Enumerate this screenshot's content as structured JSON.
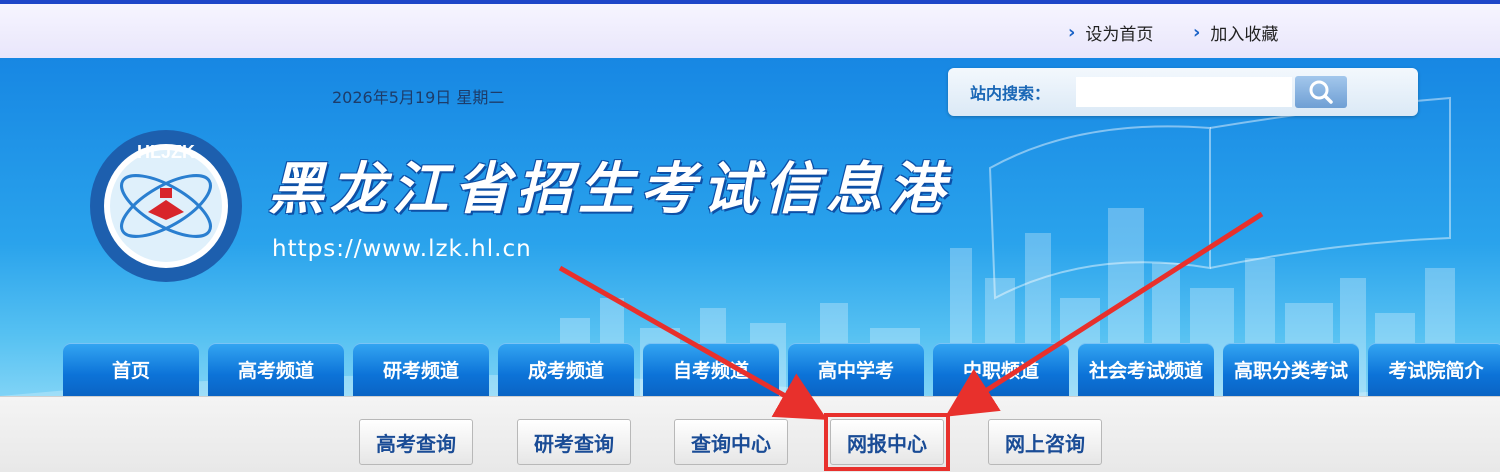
{
  "top_links": [
    {
      "label": "设为首页"
    },
    {
      "label": "加入收藏"
    }
  ],
  "header": {
    "date": "2026年5月19日 星期二",
    "site_title": "黑龙江省招生考试信息港",
    "site_url": "https://www.lzk.hl.cn",
    "logo_text": "HLJZK",
    "logo_ring_text": "黑龙江招生考试信息港"
  },
  "search": {
    "label": "站内搜索：",
    "placeholder": "",
    "value": ""
  },
  "nav": [
    {
      "label": "首页"
    },
    {
      "label": "高考频道"
    },
    {
      "label": "研考频道"
    },
    {
      "label": "成考频道"
    },
    {
      "label": "自考频道"
    },
    {
      "label": "高中学考"
    },
    {
      "label": "中职频道"
    },
    {
      "label": "社会考试频道"
    },
    {
      "label": "高职分类考试"
    },
    {
      "label": "考试院简介"
    }
  ],
  "sub_buttons": [
    {
      "label": "高考查询"
    },
    {
      "label": "研考查询"
    },
    {
      "label": "查询中心"
    },
    {
      "label": "网报中心"
    },
    {
      "label": "网上咨询"
    }
  ],
  "annotation": {
    "highlighted_button": "网报中心",
    "color": "#e8302c"
  },
  "colors": {
    "nav_blue": "#0c73d8",
    "banner_blue": "#1787e3",
    "topbar_border": "#1e47c9"
  }
}
